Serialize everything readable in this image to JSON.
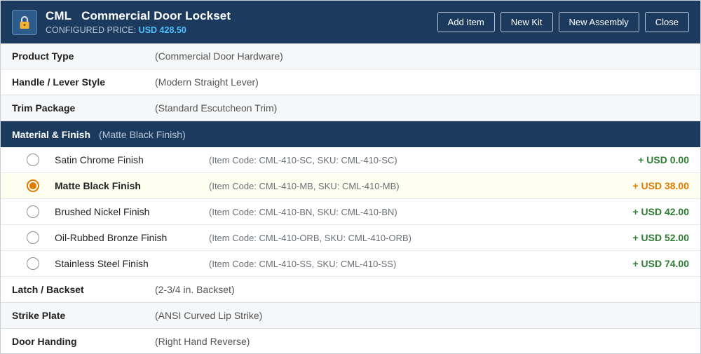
{
  "header": {
    "icon": "lock-icon",
    "code": "CML",
    "title": "Commercial Door Lockset",
    "price_label": "CONFIGURED PRICE:",
    "price_value": "USD 428.50",
    "buttons": {
      "add_item": "Add Item",
      "new_kit": "New Kit",
      "new_assembly": "New Assembly",
      "close": "Close"
    }
  },
  "rows_top": [
    {
      "label": "Product Type",
      "value": "(Commercial Door Hardware)"
    },
    {
      "label": "Handle / Lever Style",
      "value": "(Modern Straight Lever)"
    },
    {
      "label": "Trim Package",
      "value": "(Standard Escutcheon Trim)"
    }
  ],
  "section": {
    "label": "Material & Finish",
    "value": "(Matte Black Finish)"
  },
  "options": [
    {
      "name": "Satin Chrome Finish",
      "code": "(Item Code: CML-410-SC, SKU: CML-410-SC)",
      "price": "+ USD 0.00",
      "selected": false
    },
    {
      "name": "Matte Black Finish",
      "code": "(Item Code: CML-410-MB, SKU: CML-410-MB)",
      "price": "+ USD 38.00",
      "selected": true
    },
    {
      "name": "Brushed Nickel Finish",
      "code": "(Item Code: CML-410-BN, SKU: CML-410-BN)",
      "price": "+ USD 42.00",
      "selected": false
    },
    {
      "name": "Oil-Rubbed Bronze Finish",
      "code": "(Item Code: CML-410-ORB, SKU: CML-410-ORB)",
      "price": "+ USD 52.00",
      "selected": false
    },
    {
      "name": "Stainless Steel Finish",
      "code": "(Item Code: CML-410-SS, SKU: CML-410-SS)",
      "price": "+ USD 74.00",
      "selected": false
    }
  ],
  "rows_bottom": [
    {
      "label": "Latch / Backset",
      "value": "(2-3/4 in. Backset)"
    },
    {
      "label": "Strike Plate",
      "value": "(ANSI Curved Lip Strike)"
    },
    {
      "label": "Door Handing",
      "value": "(Right Hand Reverse)"
    }
  ],
  "colors": {
    "header_bg": "#1c3a5e",
    "price_accent": "#4fc1ff",
    "selected_accent": "#e07b00",
    "price_green": "#2e7d32"
  }
}
